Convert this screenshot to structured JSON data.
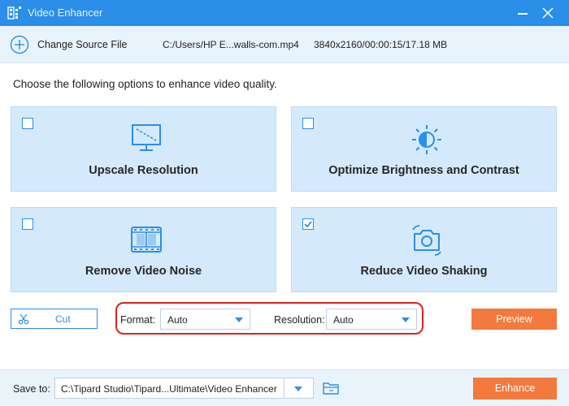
{
  "window": {
    "title": "Video Enhancer",
    "icons": {
      "app": "app-grid-icon",
      "minimize": "minimize-icon",
      "close": "close-icon"
    }
  },
  "source": {
    "change_label": "Change Source File",
    "file_path": "C:/Users/HP E...walls-com.mp4",
    "file_info": "3840x2160/00:00:15/17.18 MB",
    "add_icon": "plus-circle-icon"
  },
  "instruction": "Choose the following options to enhance video quality.",
  "options": [
    {
      "label": "Upscale Resolution",
      "checked": false,
      "icon": "monitor-icon"
    },
    {
      "label": "Optimize Brightness and Contrast",
      "checked": false,
      "icon": "sun-icon"
    },
    {
      "label": "Remove Video Noise",
      "checked": false,
      "icon": "film-strip-icon"
    },
    {
      "label": "Reduce Video Shaking",
      "checked": true,
      "icon": "camera-shake-icon"
    }
  ],
  "controls": {
    "cut_label": "Cut",
    "format_label": "Format:",
    "format_value": "Auto",
    "resolution_label": "Resolution:",
    "resolution_value": "Auto",
    "preview_label": "Preview"
  },
  "footer": {
    "save_label": "Save to:",
    "save_path": "C:\\Tipard Studio\\Tipard...Ultimate\\Video Enhancer",
    "enhance_label": "Enhance",
    "folder_icon": "folder-icon"
  },
  "colors": {
    "accent": "#2b8ee8",
    "titlebar": "#2b8ee8",
    "card_bg": "#d4eafc",
    "action": "#f27a3e",
    "highlight": "#e02020"
  }
}
